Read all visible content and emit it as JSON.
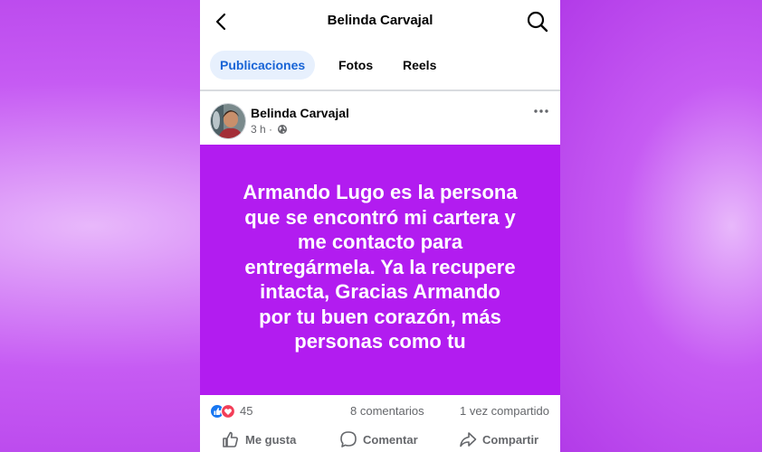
{
  "header": {
    "title": "Belinda Carvajal",
    "back_icon": "chevron-left-icon",
    "search_icon": "search-icon"
  },
  "tabs": [
    {
      "label": "Publicaciones",
      "active": true
    },
    {
      "label": "Fotos",
      "active": false
    },
    {
      "label": "Reels",
      "active": false
    }
  ],
  "post": {
    "author": "Belinda Carvajal",
    "time": "3 h ·",
    "privacy_icon": "globe-icon",
    "text": "Armando Lugo es la persona\nque se encontró mi cartera y\nme contacto para\nentregármela. Ya la recupere\nintacta, Gracias Armando\npor tu buen corazón, más\npersonas como tu",
    "background_color": "#b21cf0",
    "reactions_count": "45",
    "comments": "8 comentarios",
    "shares": "1 vez compartido"
  },
  "actions": {
    "like": "Me gusta",
    "comment": "Comentar",
    "share": "Compartir"
  },
  "colors": {
    "accent": "#1864d6",
    "like_blue": "#1877f2",
    "love_red": "#f33e58"
  }
}
